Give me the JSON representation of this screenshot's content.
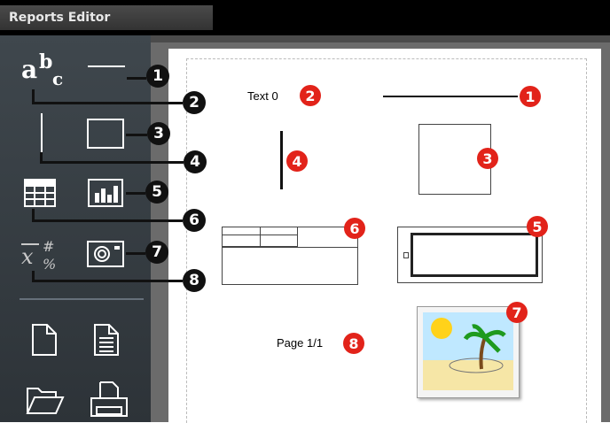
{
  "window": {
    "title": "Reports Editor"
  },
  "tools": {
    "text_glyph": "a b c",
    "line_icon": "line-icon",
    "vertical_line_icon": "vertical-line-icon",
    "rectangle_icon": "rectangle-icon",
    "table_icon": "table-icon",
    "chart_icon": "bar-chart-icon",
    "variable_icon": "variable-icon",
    "image_icon": "camera-icon",
    "file_actions": [
      "new-page-icon",
      "document-icon",
      "open-folder-icon",
      "print-icon"
    ]
  },
  "callouts": [
    "1",
    "2",
    "3",
    "4",
    "5",
    "6",
    "7",
    "8"
  ],
  "canvas": {
    "text_element": "Text 0",
    "page_element": "Page 1/1"
  },
  "colors": {
    "titlebar": "#000000",
    "sidebar": "#3f474d",
    "callout_dark": "#111111",
    "callout_red": "#e2231a"
  }
}
